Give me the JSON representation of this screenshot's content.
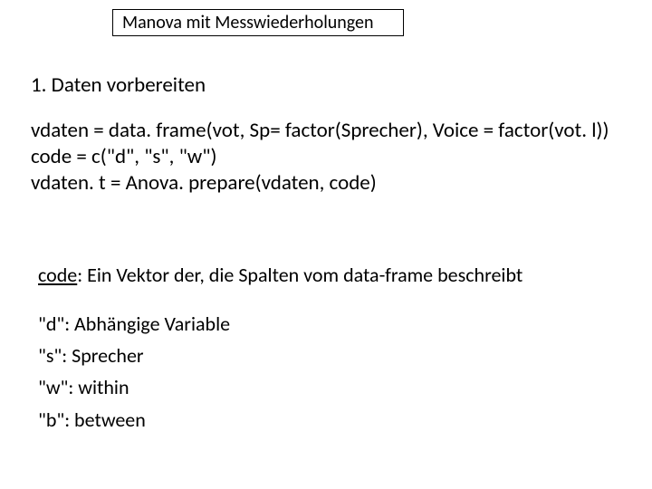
{
  "title": "Manova mit Messwiederholungen",
  "section_heading": "1. Daten vorbereiten",
  "code": {
    "l1": "vdaten = data. frame(vot, Sp= factor(Sprecher), Voice = factor(vot. l))",
    "l2": "code = c(\"d\", \"s\", \"w\")",
    "l3": "vdaten. t = Anova. prepare(vdaten, code)"
  },
  "desc": {
    "code_label": "code",
    "rest": ": Ein Vektor der, die Spalten vom data-frame beschreibt"
  },
  "defs": {
    "d": "\"d\": Abhängige Variable",
    "s": "\"s\": Sprecher",
    "w": "\"w\": within",
    "b": "\"b\": between"
  }
}
